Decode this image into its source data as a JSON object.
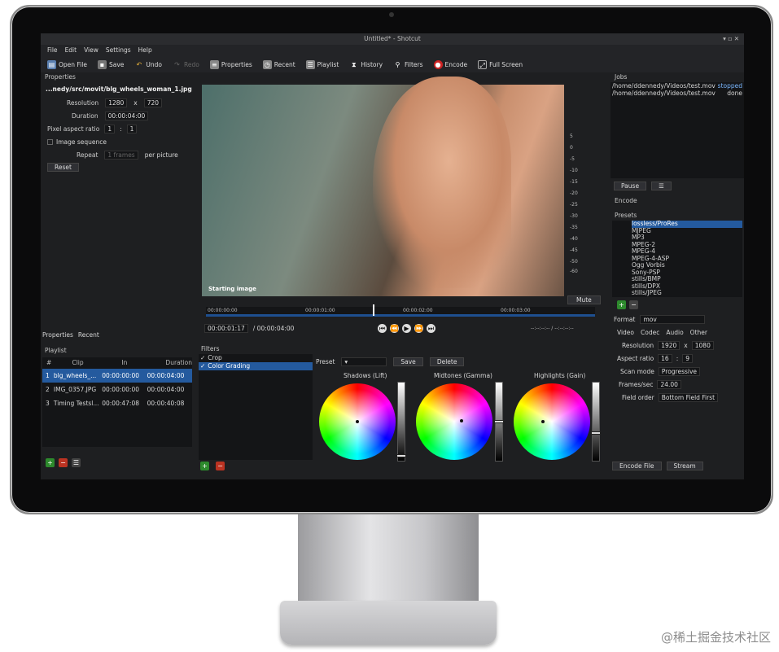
{
  "window": {
    "title": "Untitled* - Shotcut"
  },
  "menu": [
    "File",
    "Edit",
    "View",
    "Settings",
    "Help"
  ],
  "toolbar": [
    "Open File",
    "Save",
    "Undo",
    "Redo",
    "Properties",
    "Recent",
    "Playlist",
    "History",
    "Filters",
    "Encode",
    "Full Screen"
  ],
  "properties": {
    "header": "Properties",
    "filename": "...nedy/src/movit/blg_wheels_woman_1.jpg",
    "resolution_label": "Resolution",
    "res_w": "1280",
    "res_x": "x",
    "res_h": "720",
    "duration_label": "Duration",
    "duration": "00:00:04:00",
    "par_label": "Pixel aspect ratio",
    "par_a": "1",
    "par_sep": ":",
    "par_b": "1",
    "image_sequence": "Image sequence",
    "repeat_label": "Repeat",
    "repeat_value": "1 frames",
    "per_picture": "per picture",
    "reset": "Reset",
    "tab_properties": "Properties",
    "tab_recent": "Recent"
  },
  "preview": {
    "caption": "Starting image",
    "mute": "Mute",
    "ticks": [
      "00:00:00:00",
      "00:00:01:00",
      "00:00:02:00",
      "00:00:03:00"
    ],
    "current": "00:00:01:17",
    "total": "/ 00:00:04:00",
    "inout": "--:--:--:-- / --:--:--:--"
  },
  "meter": [
    "5",
    "0",
    "-5",
    "-10",
    "-15",
    "-20",
    "-25",
    "-30",
    "-35",
    "-40",
    "-45",
    "-50",
    "-60"
  ],
  "playlist": {
    "header": "Playlist",
    "cols": [
      "#",
      "Clip",
      "In",
      "Duration"
    ],
    "rows": [
      [
        "1",
        "blg_wheels_...",
        "00:00:00:00",
        "00:00:04:00"
      ],
      [
        "2",
        "IMG_0357.JPG",
        "00:00:00:00",
        "00:00:04:00"
      ],
      [
        "3",
        "Timing Testsl...",
        "00:00:47:08",
        "00:00:40:08"
      ]
    ]
  },
  "filters": {
    "header": "Filters",
    "items": [
      "Crop",
      "Color Grading"
    ],
    "preset_label": "Preset",
    "save": "Save",
    "delete": "Delete",
    "shadows": "Shadows (Lift)",
    "midtones": "Midtones (Gamma)",
    "highlights": "Highlights (Gain)"
  },
  "jobs": {
    "header": "Jobs",
    "rows": [
      [
        "/home/ddennedy/Videos/test.mov",
        "stopped"
      ],
      [
        "/home/ddennedy/Videos/test.mov",
        "done"
      ]
    ],
    "pause": "Pause"
  },
  "encode": {
    "header": "Encode",
    "presets_label": "Presets",
    "presets": [
      "lossless/ProRes",
      "MJPEG",
      "MP3",
      "MPEG-2",
      "MPEG-4",
      "MPEG-4-ASP",
      "Ogg Vorbis",
      "Sony-PSP",
      "stills/BMP",
      "stills/DPX",
      "stills/JPEG"
    ],
    "format_label": "Format",
    "format": "mov",
    "tabs": [
      "Video",
      "Codec",
      "Audio",
      "Other"
    ],
    "res_label": "Resolution",
    "res_w": "1920",
    "res_x": "x",
    "res_h": "1080",
    "aspect_label": "Aspect ratio",
    "asp_a": "16",
    "asp_sep": ":",
    "asp_b": "9",
    "scan_label": "Scan mode",
    "scan": "Progressive",
    "fps_label": "Frames/sec",
    "fps": "24.00",
    "field_label": "Field order",
    "field": "Bottom Field First",
    "encode_file": "Encode File",
    "stream": "Stream"
  },
  "watermark": "@稀土掘金技术社区"
}
